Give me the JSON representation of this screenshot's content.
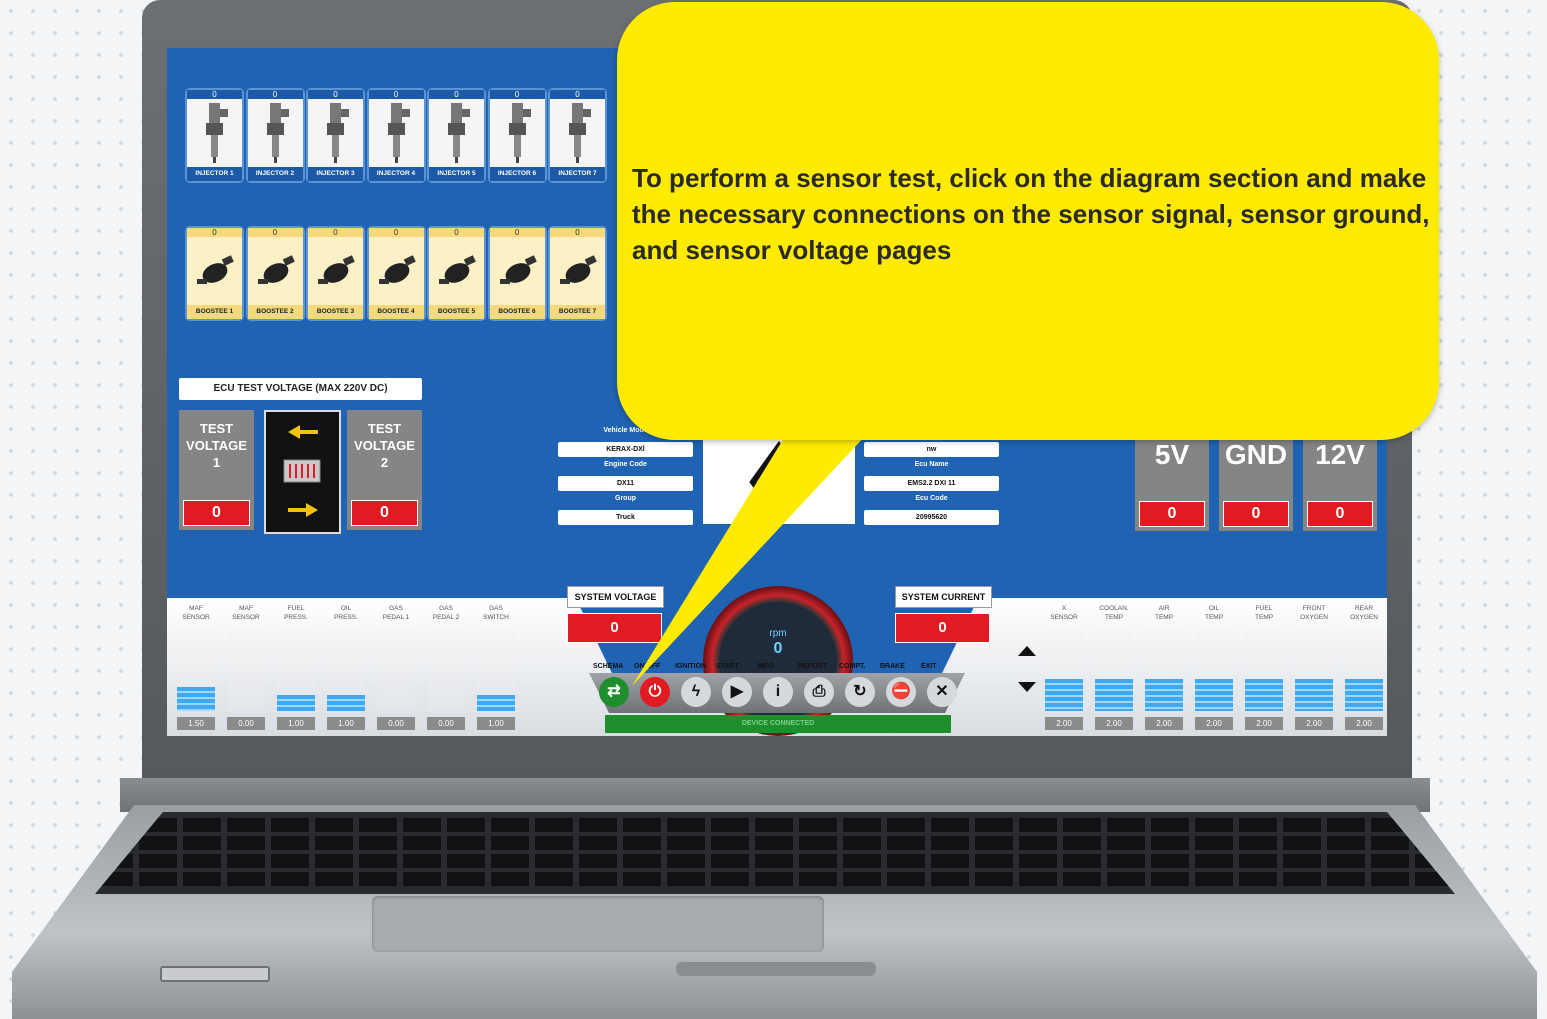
{
  "callout": {
    "text": "To perform a sensor test, click on the diagram section and make\nthe necessary connections on the sensor signal, sensor ground,\n and sensor voltage pages"
  },
  "injectors": {
    "count_value": "0",
    "labels": [
      "INJECTOR 1",
      "INJECTOR 2",
      "INJECTOR 3",
      "INJECTOR 4",
      "INJECTOR 5",
      "INJECTOR 6",
      "INJECTOR 7"
    ]
  },
  "boosters": {
    "count_value": "0",
    "labels": [
      "BOOSTEE 1",
      "BOOSTEE 2",
      "BOOSTEE 3",
      "BOOSTEE 4",
      "BOOSTEE 5",
      "BOOSTEE 6",
      "BOOSTEE 7"
    ]
  },
  "ecu_test": {
    "title": "ECU TEST VOLTAGE (MAX 220V DC)",
    "tv1_label": "TEST\nVOLTAGE\n1",
    "tv2_label": "TEST\nVOLTAGE\n2",
    "tv1_value": "0",
    "tv2_value": "0"
  },
  "vehicle": {
    "vehicle_model_label": "Vehicle Mode",
    "vehicle_model": "KERAX-DXİ",
    "engine_code_label": "Engine Code",
    "engine_code": "DX11",
    "group_label": "Group",
    "group": "Truck",
    "brand_partial": "nw",
    "ecu_name_label": "Ecu Name",
    "ecu_name": "EMS2.2 DXI 11",
    "ecu_code_label": "Ecu Code",
    "ecu_code": "20995620"
  },
  "voltages": {
    "v5_label": "5V",
    "v5_value": "0",
    "gnd_label": "GND",
    "gnd_value": "0",
    "v12_label": "12V",
    "v12_value": "0"
  },
  "system": {
    "voltage_label": "SYSTEM VOLTAGE",
    "voltage_value": "0",
    "current_label": "SYSTEM CURRENT",
    "current_value": "0",
    "rpm_label": "rpm",
    "rpm_value": "0"
  },
  "sensors_left": [
    {
      "label": "MAF\nSENSOR",
      "value": "1.50",
      "level": 0.3
    },
    {
      "label": "MAF\nSENSOR",
      "value": "0.00",
      "level": 0
    },
    {
      "label": "FUEL\nPRESS.",
      "value": "1.00",
      "level": 0.2
    },
    {
      "label": "OIL\nPRESS.",
      "value": "1.00",
      "level": 0.2
    },
    {
      "label": "GAS\nPEDAL 1",
      "value": "0.00",
      "level": 0
    },
    {
      "label": "GAS\nPEDAL 2",
      "value": "0.00",
      "level": 0
    },
    {
      "label": "GAS\nSWITCH",
      "value": "1.00",
      "level": 0.2
    }
  ],
  "sensors_right": [
    {
      "label": "X\nSENSOR",
      "value": "2.00",
      "level": 0.4
    },
    {
      "label": "COOLAN.\nTEMP",
      "value": "2.00",
      "level": 0.4
    },
    {
      "label": "AIR\nTEMP",
      "value": "2.00",
      "level": 0.4
    },
    {
      "label": "OIL\nTEMP",
      "value": "2.00",
      "level": 0.4
    },
    {
      "label": "FUEL\nTEMP",
      "value": "2.00",
      "level": 0.4
    },
    {
      "label": "FRONT\nOXYGEN",
      "value": "2.00",
      "level": 0.4
    },
    {
      "label": "REAR\nOXYGEN",
      "value": "2.00",
      "level": 0.4
    }
  ],
  "toolbar": {
    "labels": [
      "SCHEMA",
      "ON/OFF",
      "IGNITION",
      "START",
      "INFO",
      "REPORT",
      "COMPT.",
      "BRAKE",
      "EXIT"
    ],
    "icons": [
      "shuffle-icon",
      "power-icon",
      "lightning-icon",
      "play-icon",
      "info-icon",
      "print-icon",
      "refresh-icon",
      "brake-icon",
      "close-icon"
    ],
    "status": "DEVICE CONNECTED"
  },
  "colors": {
    "callout_yellow": "#ffeb00",
    "screen_blue": "#1f63b2",
    "value_red": "#e21b22",
    "status_green": "#1e8f2c"
  }
}
